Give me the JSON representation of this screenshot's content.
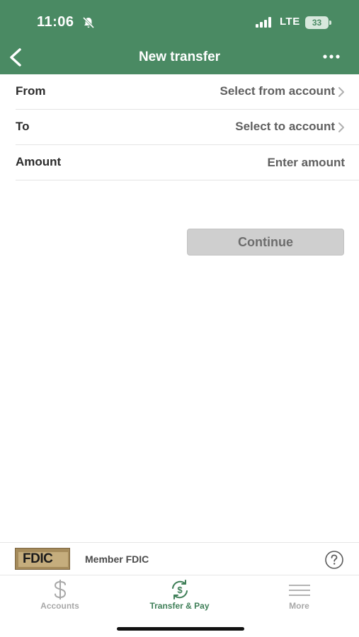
{
  "status_bar": {
    "time": "11:06",
    "network": "LTE",
    "battery_level": "33"
  },
  "header": {
    "title": "New transfer",
    "back_icon": "chevron-left-icon",
    "more_icon": "ellipsis-icon",
    "background_color": "#4a8a63"
  },
  "form": {
    "from": {
      "label": "From",
      "value": "Select from account"
    },
    "to": {
      "label": "To",
      "value": "Select to account"
    },
    "amount": {
      "label": "Amount",
      "placeholder": "Enter amount"
    }
  },
  "continue_button": {
    "label": "Continue",
    "enabled": false
  },
  "fdic": {
    "logo_text": "FDIC",
    "text": "Member FDIC",
    "help_icon": "question-circle-icon"
  },
  "tab_bar": {
    "tabs": [
      {
        "label": "Accounts",
        "icon": "dollar-icon",
        "active": false
      },
      {
        "label": "Transfer & Pay",
        "icon": "transfer-dollar-icon",
        "active": true
      },
      {
        "label": "More",
        "icon": "menu-icon",
        "active": false
      }
    ],
    "active_color": "#3f7f58",
    "inactive_color": "#a8a8a8"
  }
}
